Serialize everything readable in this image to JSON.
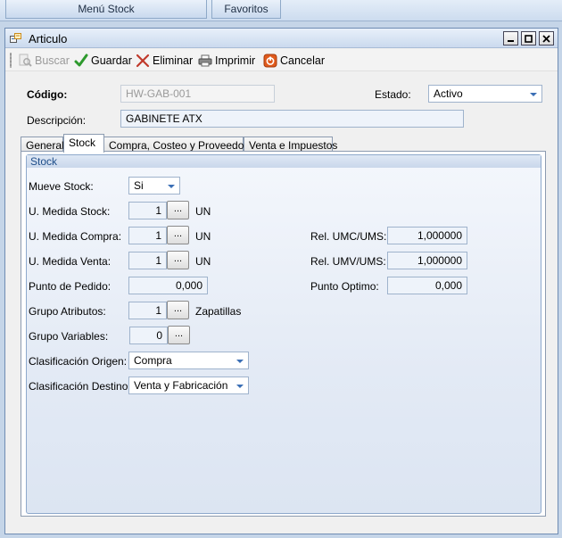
{
  "topbar": {
    "menu_stock": "Menú Stock",
    "favoritos": "Favoritos"
  },
  "window": {
    "title": "Articulo"
  },
  "toolbar": {
    "buscar": "Buscar",
    "guardar": "Guardar",
    "eliminar": "Eliminar",
    "imprimir": "Imprimir",
    "cancelar": "Cancelar"
  },
  "header": {
    "codigo_label": "Código:",
    "codigo_value": "HW-GAB-001",
    "estado_label": "Estado:",
    "estado_value": "Activo",
    "descripcion_label": "Descripción:",
    "descripcion_value": "GABINETE ATX"
  },
  "tabs": [
    {
      "label": "General"
    },
    {
      "label": "Stock"
    },
    {
      "label": "Compra, Costeo y Proveedores"
    },
    {
      "label": "Venta e Impuestos"
    }
  ],
  "stock": {
    "group_title": "Stock",
    "mueve_stock_label": "Mueve Stock:",
    "mueve_stock_value": "Si",
    "um_stock_label": "U. Medida Stock:",
    "um_stock_value": "1",
    "um_stock_unit": "UN",
    "um_compra_label": "U. Medida Compra:",
    "um_compra_value": "1",
    "um_compra_unit": "UN",
    "um_venta_label": "U. Medida Venta:",
    "um_venta_value": "1",
    "um_venta_unit": "UN",
    "punto_pedido_label": "Punto de Pedido:",
    "punto_pedido_value": "0,000",
    "grupo_atributos_label": "Grupo Atributos:",
    "grupo_atributos_value": "1",
    "grupo_atributos_desc": "Zapatillas",
    "grupo_variables_label": "Grupo Variables:",
    "grupo_variables_value": "0",
    "clas_origen_label": "Clasificación Origen:",
    "clas_origen_value": "Compra",
    "clas_destino_label": "Clasificación Destino:",
    "clas_destino_value": "Venta y Fabricación",
    "rel_umc_label": "Rel. UMC/UMS:",
    "rel_umc_value": "1,000000",
    "rel_umv_label": "Rel. UMV/UMS:",
    "rel_umv_value": "1,000000",
    "punto_optimo_label": "Punto Optimo:",
    "punto_optimo_value": "0,000",
    "dots_label": "..."
  },
  "icons": {
    "buscar": "search-icon",
    "guardar": "checkmark-icon",
    "eliminar": "x-icon",
    "imprimir": "printer-icon",
    "cancelar": "cancel-icon",
    "window": "form-icon"
  },
  "colors": {
    "accent": "#1f4e8a",
    "window_border": "#6f8cb3",
    "guardar_green": "#2e9a2e",
    "eliminar_red": "#c0392b",
    "cancelar_orange": "#e05a1c"
  }
}
